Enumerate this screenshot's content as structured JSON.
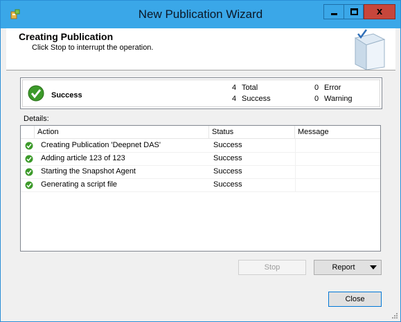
{
  "window": {
    "title": "New Publication Wizard",
    "close_glyph": "x"
  },
  "header": {
    "title": "Creating Publication",
    "subtitle": "Click Stop to interrupt the operation."
  },
  "summary": {
    "status": "Success",
    "total_count": "4",
    "total_label": "Total",
    "success_count": "4",
    "success_label": "Success",
    "error_count": "0",
    "error_label": "Error",
    "warning_count": "0",
    "warning_label": "Warning"
  },
  "details": {
    "label": "Details:",
    "columns": {
      "action": "Action",
      "status": "Status",
      "message": "Message"
    },
    "rows": [
      {
        "action": "Creating Publication 'Deepnet DAS'",
        "status": "Success",
        "message": ""
      },
      {
        "action": "Adding article 123 of 123",
        "status": "Success",
        "message": ""
      },
      {
        "action": "Starting the Snapshot Agent",
        "status": "Success",
        "message": ""
      },
      {
        "action": "Generating a script file",
        "status": "Success",
        "message": ""
      }
    ]
  },
  "buttons": {
    "stop": "Stop",
    "report": "Report",
    "close": "Close"
  },
  "colors": {
    "titlebar": "#3aa7e8",
    "close": "#c7463b",
    "success": "#3c9a2a"
  },
  "icons": [
    "app-icon",
    "minimize-icon",
    "maximize-icon",
    "close-icon",
    "book-icon",
    "success-icon",
    "dropdown-arrow-icon"
  ]
}
